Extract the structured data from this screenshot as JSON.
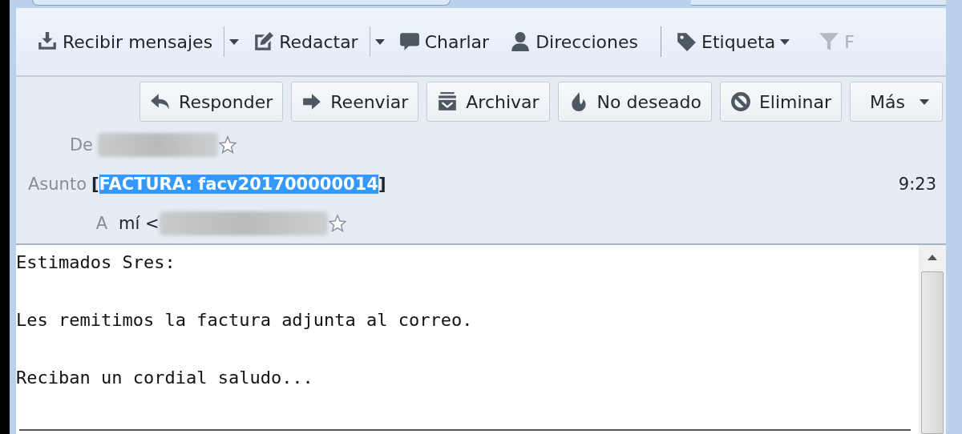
{
  "toolbar": {
    "items": [
      {
        "kind": "split",
        "label": "Recibir mensajes"
      },
      {
        "kind": "split",
        "label": "Redactar"
      },
      {
        "kind": "plain",
        "label": "Charlar"
      },
      {
        "kind": "plain",
        "label": "Direcciones"
      },
      {
        "kind": "separator"
      },
      {
        "kind": "menu",
        "label": "Etiqueta"
      },
      {
        "kind": "cut",
        "label": "F",
        "disabled": true
      }
    ]
  },
  "message": {
    "actions": [
      {
        "kind": "plain",
        "label": "Responder"
      },
      {
        "kind": "plain",
        "label": "Reenviar"
      },
      {
        "kind": "plain",
        "label": "Archivar"
      },
      {
        "kind": "plain",
        "label": "No deseado"
      },
      {
        "kind": "plain",
        "label": "Eliminar"
      },
      {
        "kind": "menu",
        "label": "Más"
      }
    ],
    "from": {
      "label": "De"
    },
    "subject": {
      "label": "Asunto",
      "parts": [
        {
          "text": "[",
          "selected": false
        },
        {
          "text": "FACTURA: facv201700000014",
          "selected": true
        },
        {
          "text": "]",
          "selected": false
        }
      ],
      "time": "9:23"
    },
    "to": {
      "label": "A",
      "value": "mí <"
    },
    "body": [
      "Estimados Sres:",
      "Les remitimos la factura adjunta al correo.",
      "Reciban un cordial saludo..."
    ]
  }
}
